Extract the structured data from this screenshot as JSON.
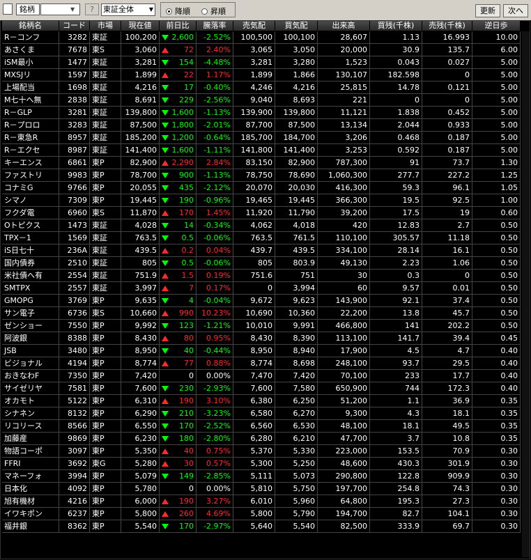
{
  "toolbar": {
    "field_label": "銘柄",
    "help": "?",
    "market": "東証全体",
    "sort_desc": "降順",
    "sort_asc": "昇順",
    "sort_selected": "desc",
    "refresh": "更新",
    "next": "次へ"
  },
  "columns": [
    "銘柄名",
    "コード",
    "市場",
    "現在値",
    "前日比",
    "騰落率",
    "売気配",
    "買気配",
    "出来高",
    "買残(千株)",
    "売残(千株)",
    "逆日歩"
  ],
  "rows": [
    {
      "name": "R－コンフ",
      "code": "3282",
      "market": "東証",
      "price": "100,200",
      "dir": "down",
      "change": "2,600",
      "rate": "-2.52%",
      "ask": "100,500",
      "bid": "100,100",
      "volume": "28,607",
      "buy": "1.13",
      "sell": "16.993",
      "gyaku": "10.00"
    },
    {
      "name": "あさくま",
      "code": "7678",
      "market": "東S",
      "price": "3,060",
      "dir": "up",
      "change": "72",
      "rate": "2.40%",
      "ask": "3,065",
      "bid": "3,050",
      "volume": "20,000",
      "buy": "30.9",
      "sell": "135.7",
      "gyaku": "6.00"
    },
    {
      "name": "iSM最小",
      "code": "1477",
      "market": "東証",
      "price": "3,281",
      "dir": "down",
      "change": "154",
      "rate": "-4.48%",
      "ask": "3,281",
      "bid": "3,280",
      "volume": "1,523",
      "buy": "0.043",
      "sell": "0.027",
      "gyaku": "5.00"
    },
    {
      "name": "MXSJリ",
      "code": "1597",
      "market": "東証",
      "price": "1,899",
      "dir": "up",
      "change": "22",
      "rate": "1.17%",
      "ask": "1,899",
      "bid": "1,866",
      "volume": "130,107",
      "buy": "182.598",
      "sell": "0",
      "gyaku": "5.00"
    },
    {
      "name": "上場配当",
      "code": "1698",
      "market": "東証",
      "price": "4,216",
      "dir": "down",
      "change": "17",
      "rate": "-0.40%",
      "ask": "4,246",
      "bid": "4,216",
      "volume": "25,815",
      "buy": "14.78",
      "sell": "0.121",
      "gyaku": "5.00"
    },
    {
      "name": "M七十へ無",
      "code": "2838",
      "market": "東証",
      "price": "8,691",
      "dir": "down",
      "change": "229",
      "rate": "-2.56%",
      "ask": "9,040",
      "bid": "8,693",
      "volume": "221",
      "buy": "0",
      "sell": "0",
      "gyaku": "5.00"
    },
    {
      "name": "R－GLP",
      "code": "3281",
      "market": "東証",
      "price": "139,800",
      "dir": "down",
      "change": "1,600",
      "rate": "-1.13%",
      "ask": "139,900",
      "bid": "139,800",
      "volume": "11,121",
      "buy": "1.838",
      "sell": "0.452",
      "gyaku": "5.00"
    },
    {
      "name": "R－プロロ",
      "code": "3283",
      "market": "東証",
      "price": "87,500",
      "dir": "down",
      "change": "1,800",
      "rate": "-2.01%",
      "ask": "87,700",
      "bid": "87,500",
      "volume": "13,134",
      "buy": "2.044",
      "sell": "0.933",
      "gyaku": "5.00"
    },
    {
      "name": "R－東急R",
      "code": "8957",
      "market": "東証",
      "price": "185,200",
      "dir": "down",
      "change": "1,200",
      "rate": "-0.64%",
      "ask": "185,700",
      "bid": "184,700",
      "volume": "3,206",
      "buy": "0.468",
      "sell": "0.187",
      "gyaku": "5.00"
    },
    {
      "name": "R－エクセ",
      "code": "8987",
      "market": "東証",
      "price": "141,400",
      "dir": "down",
      "change": "1,600",
      "rate": "-1.11%",
      "ask": "141,800",
      "bid": "141,400",
      "volume": "3,253",
      "buy": "0.592",
      "sell": "0.187",
      "gyaku": "5.00"
    },
    {
      "name": "キーエンス",
      "code": "6861",
      "market": "東P",
      "price": "82,900",
      "dir": "up",
      "change": "2,290",
      "rate": "2.84%",
      "ask": "83,150",
      "bid": "82,900",
      "volume": "787,300",
      "buy": "91",
      "sell": "73.7",
      "gyaku": "1.30"
    },
    {
      "name": "ファストリ",
      "code": "9983",
      "market": "東P",
      "price": "78,700",
      "dir": "down",
      "change": "900",
      "rate": "-1.13%",
      "ask": "78,750",
      "bid": "78,690",
      "volume": "1,060,300",
      "buy": "277.7",
      "sell": "227.2",
      "gyaku": "1.25"
    },
    {
      "name": "コナミG",
      "code": "9766",
      "market": "東P",
      "price": "20,055",
      "dir": "down",
      "change": "435",
      "rate": "-2.12%",
      "ask": "20,070",
      "bid": "20,030",
      "volume": "416,300",
      "buy": "59.3",
      "sell": "96.1",
      "gyaku": "1.05"
    },
    {
      "name": "シマノ",
      "code": "7309",
      "market": "東P",
      "price": "19,445",
      "dir": "down",
      "change": "190",
      "rate": "-0.96%",
      "ask": "19,465",
      "bid": "19,445",
      "volume": "366,300",
      "buy": "19.5",
      "sell": "92.5",
      "gyaku": "1.00"
    },
    {
      "name": "フクダ電",
      "code": "6960",
      "market": "東S",
      "price": "11,870",
      "dir": "up",
      "change": "170",
      "rate": "1.45%",
      "ask": "11,920",
      "bid": "11,790",
      "volume": "39,200",
      "buy": "17.5",
      "sell": "19",
      "gyaku": "0.60"
    },
    {
      "name": "Oトピクス",
      "code": "1473",
      "market": "東証",
      "price": "4,028",
      "dir": "down",
      "change": "14",
      "rate": "-0.34%",
      "ask": "4,062",
      "bid": "4,018",
      "volume": "420",
      "buy": "12.83",
      "sell": "2.7",
      "gyaku": "0.50"
    },
    {
      "name": "TPX－1",
      "code": "1569",
      "market": "東証",
      "price": "763.5",
      "dir": "down",
      "change": "0.5",
      "rate": "-0.06%",
      "ask": "763.5",
      "bid": "761.5",
      "volume": "110,100",
      "buy": "305.57",
      "sell": "11.18",
      "gyaku": "0.50"
    },
    {
      "name": "iS日七十",
      "code": "236A",
      "market": "東証",
      "price": "439.5",
      "dir": "up",
      "change": "0.2",
      "rate": "0.04%",
      "ask": "439.7",
      "bid": "439.5",
      "volume": "334,100",
      "buy": "28.14",
      "sell": "16.1",
      "gyaku": "0.50"
    },
    {
      "name": "国内債券",
      "code": "2510",
      "market": "東証",
      "price": "805",
      "dir": "down",
      "change": "0.5",
      "rate": "-0.06%",
      "ask": "805",
      "bid": "803.9",
      "volume": "49,130",
      "buy": "2.23",
      "sell": "1.06",
      "gyaku": "0.50"
    },
    {
      "name": "米社債へ有",
      "code": "2554",
      "market": "東証",
      "price": "751.9",
      "dir": "up",
      "change": "1.5",
      "rate": "0.19%",
      "ask": "751.6",
      "bid": "751",
      "volume": "30",
      "buy": "0.3",
      "sell": "0",
      "gyaku": "0.50"
    },
    {
      "name": "SMTPX",
      "code": "2557",
      "market": "東証",
      "price": "3,997",
      "dir": "up",
      "change": "7",
      "rate": "0.17%",
      "ask": "0",
      "bid": "3,994",
      "volume": "60",
      "buy": "9.57",
      "sell": "0.01",
      "gyaku": "0.50"
    },
    {
      "name": "GMOPG",
      "code": "3769",
      "market": "東P",
      "price": "9,635",
      "dir": "down",
      "change": "4",
      "rate": "-0.04%",
      "ask": "9,672",
      "bid": "9,623",
      "volume": "143,900",
      "buy": "92.1",
      "sell": "37.4",
      "gyaku": "0.50"
    },
    {
      "name": "サン電子",
      "code": "6736",
      "market": "東S",
      "price": "10,660",
      "dir": "up",
      "change": "990",
      "rate": "10.23%",
      "ask": "10,690",
      "bid": "10,360",
      "volume": "22,200",
      "buy": "13.8",
      "sell": "45.7",
      "gyaku": "0.50"
    },
    {
      "name": "ゼンショー",
      "code": "7550",
      "market": "東P",
      "price": "9,992",
      "dir": "down",
      "change": "123",
      "rate": "-1.21%",
      "ask": "10,010",
      "bid": "9,991",
      "volume": "466,800",
      "buy": "141",
      "sell": "202.2",
      "gyaku": "0.50"
    },
    {
      "name": "阿波銀",
      "code": "8388",
      "market": "東P",
      "price": "8,430",
      "dir": "up",
      "change": "80",
      "rate": "0.95%",
      "ask": "8,430",
      "bid": "8,390",
      "volume": "113,100",
      "buy": "141.7",
      "sell": "39.4",
      "gyaku": "0.45"
    },
    {
      "name": "JSB",
      "code": "3480",
      "market": "東P",
      "price": "8,950",
      "dir": "down",
      "change": "40",
      "rate": "-0.44%",
      "ask": "8,950",
      "bid": "8,940",
      "volume": "17,900",
      "buy": "4.5",
      "sell": "4.7",
      "gyaku": "0.40"
    },
    {
      "name": "ビジョナル",
      "code": "4194",
      "market": "東P",
      "price": "8,774",
      "dir": "up",
      "change": "77",
      "rate": "0.88%",
      "ask": "8,774",
      "bid": "8,698",
      "volume": "248,100",
      "buy": "93.7",
      "sell": "29.5",
      "gyaku": "0.40"
    },
    {
      "name": "おきなわF",
      "code": "7350",
      "market": "東P",
      "price": "7,420",
      "dir": "none",
      "change": "0",
      "rate": "0.00%",
      "ask": "7,470",
      "bid": "7,420",
      "volume": "70,100",
      "buy": "233",
      "sell": "17.7",
      "gyaku": "0.40"
    },
    {
      "name": "サイゼリヤ",
      "code": "7581",
      "market": "東P",
      "price": "7,600",
      "dir": "down",
      "change": "230",
      "rate": "-2.93%",
      "ask": "7,600",
      "bid": "7,580",
      "volume": "650,900",
      "buy": "744",
      "sell": "172.3",
      "gyaku": "0.40"
    },
    {
      "name": "オカモト",
      "code": "5122",
      "market": "東P",
      "price": "6,310",
      "dir": "up",
      "change": "190",
      "rate": "3.10%",
      "ask": "6,380",
      "bid": "6,250",
      "volume": "51,200",
      "buy": "1.1",
      "sell": "36.9",
      "gyaku": "0.35"
    },
    {
      "name": "シナネン",
      "code": "8132",
      "market": "東P",
      "price": "6,290",
      "dir": "down",
      "change": "210",
      "rate": "-3.23%",
      "ask": "6,580",
      "bid": "6,270",
      "volume": "9,300",
      "buy": "4.3",
      "sell": "18.1",
      "gyaku": "0.35"
    },
    {
      "name": "リコリース",
      "code": "8566",
      "market": "東P",
      "price": "6,550",
      "dir": "down",
      "change": "170",
      "rate": "-2.52%",
      "ask": "6,560",
      "bid": "6,530",
      "volume": "48,100",
      "buy": "18.1",
      "sell": "49.5",
      "gyaku": "0.35"
    },
    {
      "name": "加藤産",
      "code": "9869",
      "market": "東P",
      "price": "6,230",
      "dir": "down",
      "change": "180",
      "rate": "-2.80%",
      "ask": "6,280",
      "bid": "6,210",
      "volume": "47,700",
      "buy": "3.7",
      "sell": "10.8",
      "gyaku": "0.35"
    },
    {
      "name": "物語コーポ",
      "code": "3097",
      "market": "東P",
      "price": "5,350",
      "dir": "up",
      "change": "40",
      "rate": "0.75%",
      "ask": "5,370",
      "bid": "5,330",
      "volume": "223,000",
      "buy": "153.5",
      "sell": "70.9",
      "gyaku": "0.30"
    },
    {
      "name": "FFRI",
      "code": "3692",
      "market": "東G",
      "price": "5,280",
      "dir": "up",
      "change": "30",
      "rate": "0.57%",
      "ask": "5,300",
      "bid": "5,250",
      "volume": "48,600",
      "buy": "430.3",
      "sell": "301.9",
      "gyaku": "0.30"
    },
    {
      "name": "マネーフォ",
      "code": "3994",
      "market": "東P",
      "price": "5,079",
      "dir": "down",
      "change": "149",
      "rate": "-2.85%",
      "ask": "5,111",
      "bid": "5,073",
      "volume": "290,800",
      "buy": "122.8",
      "sell": "909.9",
      "gyaku": "0.30"
    },
    {
      "name": "日本化",
      "code": "4092",
      "market": "東P",
      "price": "5,780",
      "dir": "none",
      "change": "0",
      "rate": "0.00%",
      "ask": "5,810",
      "bid": "5,750",
      "volume": "197,700",
      "buy": "254.8",
      "sell": "74.3",
      "gyaku": "0.30"
    },
    {
      "name": "旭有機材",
      "code": "4216",
      "market": "東P",
      "price": "6,000",
      "dir": "up",
      "change": "190",
      "rate": "3.27%",
      "ask": "6,010",
      "bid": "5,960",
      "volume": "64,800",
      "buy": "195.3",
      "sell": "27.3",
      "gyaku": "0.30"
    },
    {
      "name": "イワキポン",
      "code": "6237",
      "market": "東P",
      "price": "5,800",
      "dir": "up",
      "change": "260",
      "rate": "4.69%",
      "ask": "5,800",
      "bid": "5,790",
      "volume": "194,700",
      "buy": "82.7",
      "sell": "104.1",
      "gyaku": "0.30"
    },
    {
      "name": "福井銀",
      "code": "8362",
      "market": "東P",
      "price": "5,540",
      "dir": "down",
      "change": "170",
      "rate": "-2.97%",
      "ask": "5,640",
      "bid": "5,540",
      "volume": "82,500",
      "buy": "333.9",
      "sell": "69.7",
      "gyaku": "0.30"
    }
  ]
}
